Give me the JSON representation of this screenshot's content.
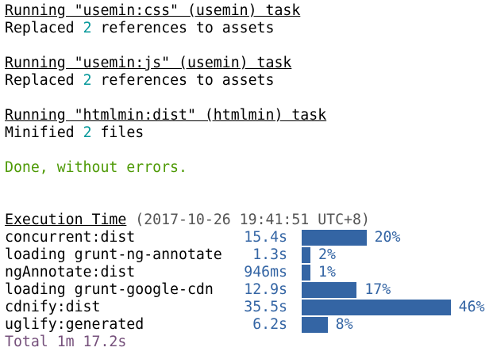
{
  "log": [
    {
      "title": "Running \"usemin:css\" (usemin) task",
      "pre": "Replaced ",
      "count": "2",
      "post": " references to assets"
    },
    {
      "title": "Running \"usemin:js\" (usemin) task",
      "pre": "Replaced ",
      "count": "2",
      "post": " references to assets"
    },
    {
      "title": "Running \"htmlmin:dist\" (htmlmin) task",
      "pre": "Minified ",
      "count": "2",
      "post": " files"
    }
  ],
  "done": "Done, without errors.",
  "execution": {
    "title": "Execution Time",
    "timestamp": "(2017-10-26 19:41:51 UTC+8)",
    "rows": [
      {
        "name": "concurrent:dist",
        "time": "15.4s",
        "percent": 20,
        "label": "20%"
      },
      {
        "name": "loading grunt-ng-annotate",
        "time": "1.3s",
        "percent": 2,
        "label": "2%"
      },
      {
        "name": "ngAnnotate:dist",
        "time": "946ms",
        "percent": 1,
        "label": "1%"
      },
      {
        "name": "loading grunt-google-cdn",
        "time": "12.9s",
        "percent": 17,
        "label": "17%"
      },
      {
        "name": "cdnify:dist",
        "time": "35.5s",
        "percent": 46,
        "label": "46%"
      },
      {
        "name": "uglify:generated",
        "time": "6.2s",
        "percent": 8,
        "label": "8%"
      }
    ],
    "total": "Total 1m 17.2s"
  },
  "colors": {
    "bar": "#3465a4",
    "count": "#06989a",
    "done": "#4e9a06",
    "total": "#75507b"
  }
}
